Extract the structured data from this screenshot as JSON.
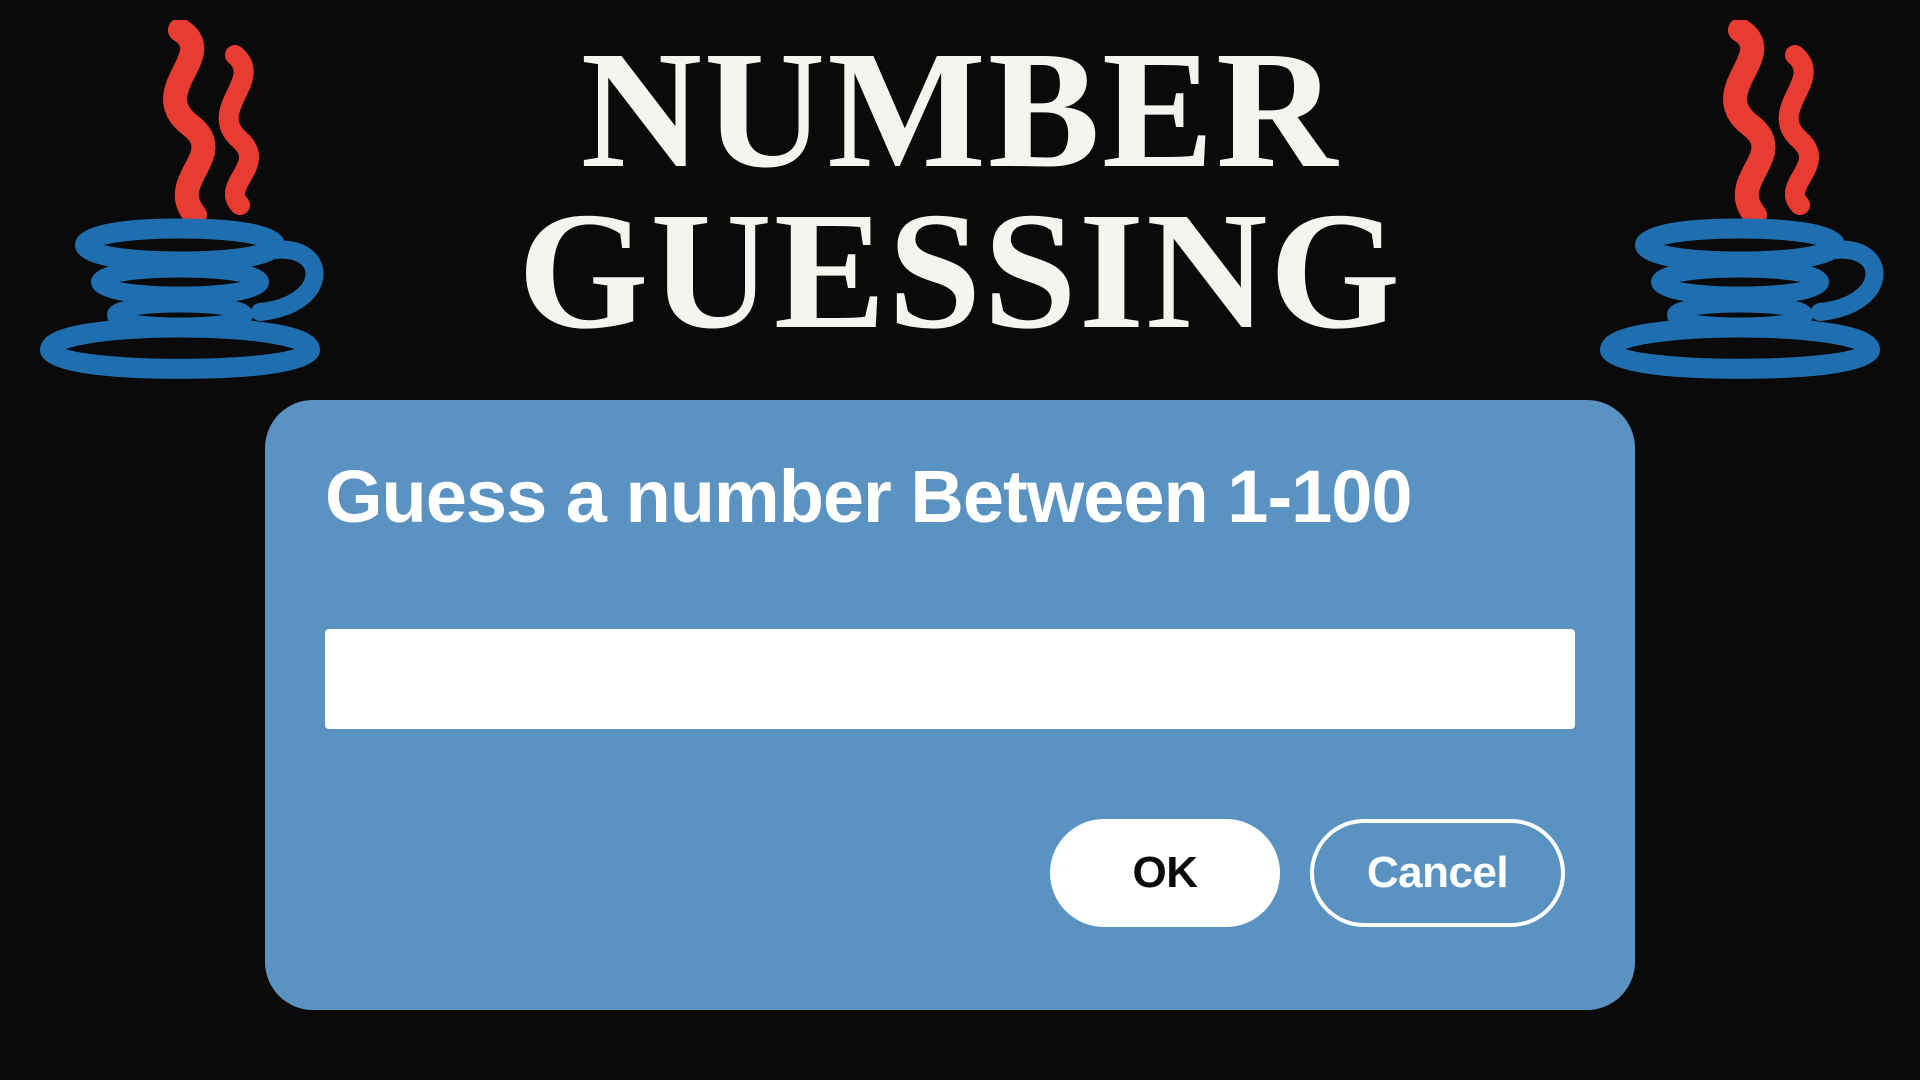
{
  "title": "NUMBER\nGUESSING",
  "icons": {
    "left": "java-logo-icon",
    "right": "java-logo-icon"
  },
  "dialog": {
    "prompt": "Guess a number Between 1-100",
    "input_value": "",
    "input_placeholder": "",
    "ok_label": "OK",
    "cancel_label": "Cancel"
  },
  "colors": {
    "background": "#0a0a0a",
    "panel": "#5a93c2",
    "title_text": "#f5f5ef",
    "steam": "#e83c32",
    "cup": "#1f6fb0"
  }
}
